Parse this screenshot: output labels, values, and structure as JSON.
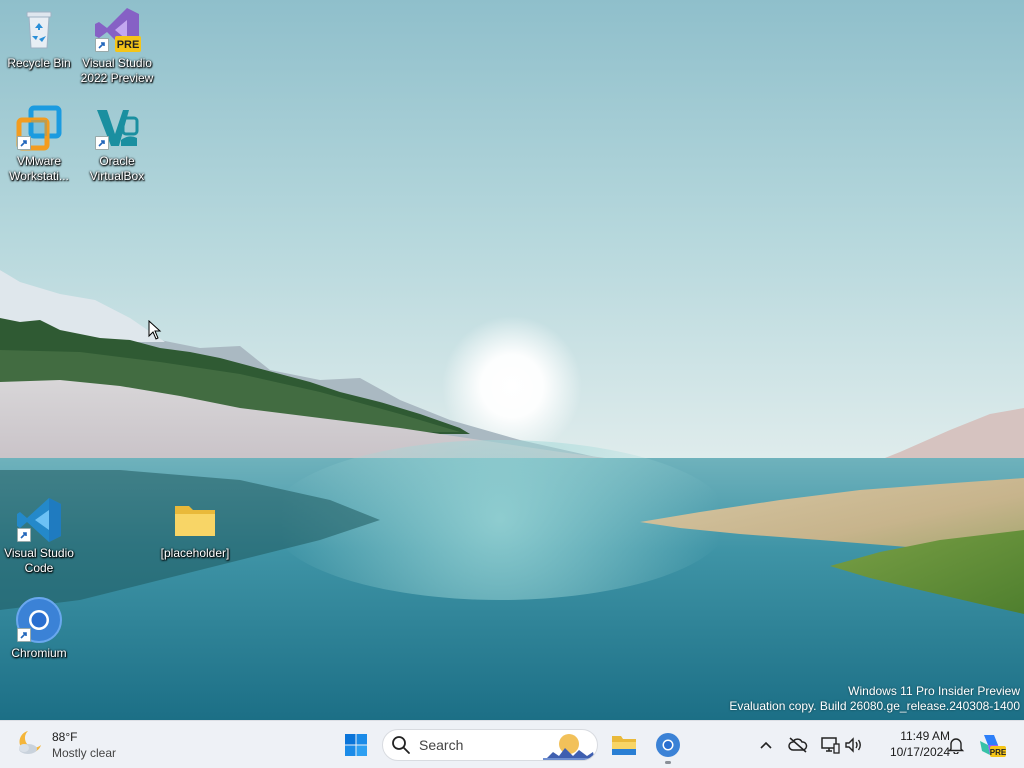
{
  "desktop": {
    "icons": [
      {
        "label": "Recycle Bin",
        "icon": "recycle-bin-icon"
      },
      {
        "label": "Visual Studio 2022 Preview",
        "icon": "visual-studio-preview-icon",
        "badge": "PRE"
      },
      {
        "label": "VMware Workstati...",
        "icon": "vmware-workstation-icon"
      },
      {
        "label": "Oracle VirtualBox",
        "icon": "virtualbox-icon"
      },
      {
        "label": "Visual Studio Code",
        "icon": "vscode-icon"
      },
      {
        "label": "[placeholder]",
        "icon": "folder-icon"
      },
      {
        "label": "Chromium",
        "icon": "chromium-icon"
      }
    ],
    "watermark": {
      "line1": "Windows 11 Pro Insider Preview",
      "line2": "Evaluation copy. Build 26080.ge_release.240308-1400"
    }
  },
  "taskbar": {
    "weather": {
      "temp": "88°F",
      "condition": "Mostly clear",
      "icon": "weather-moon-cloud-icon"
    },
    "start": {
      "icon": "windows-start-icon"
    },
    "search": {
      "placeholder": "Search",
      "icon": "search-icon"
    },
    "pinned": [
      {
        "name": "File Explorer",
        "icon": "file-explorer-icon"
      },
      {
        "name": "Chromium",
        "icon": "chromium-icon",
        "running": true
      }
    ],
    "tray": {
      "icons": [
        "chevron-up-icon",
        "onedrive-offline-icon",
        "network-icon",
        "volume-icon",
        "notification-bell-icon",
        "copilot-icon"
      ],
      "copilot_badge": "PRE"
    },
    "clock": {
      "time": "11:49 AM",
      "date": "10/17/2024"
    }
  },
  "colors": {
    "accent": "#0067c0",
    "taskbar_bg": "#eef1f6",
    "folder": "#f8d566",
    "vmware": "#1b9be0",
    "vscode": "#2489ca",
    "vs_purple": "#8661c5"
  }
}
